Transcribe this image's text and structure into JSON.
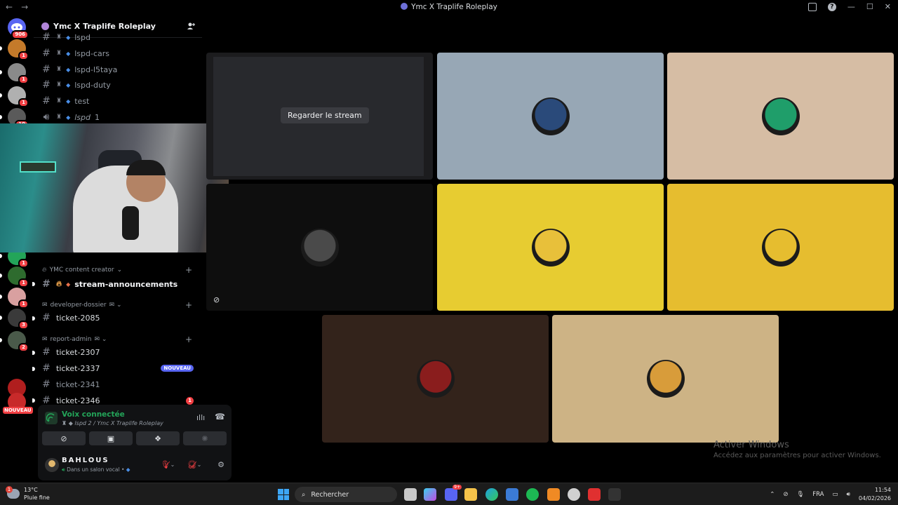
{
  "window": {
    "title": "Ymc X Traplife Roleplay",
    "back": "←",
    "forward": "→",
    "help_icon": "?",
    "minimize": "—",
    "maximize": "☐",
    "close": "✕"
  },
  "rail": {
    "home_badge": "906",
    "servers": [
      {
        "badge": "1",
        "color": "#c47a2a"
      },
      {
        "badge": "1",
        "color": "#8a8a8a"
      },
      {
        "badge": "1",
        "color": "#b0b0b0"
      },
      {
        "badge": "10",
        "color": "#5a5a5a"
      },
      {
        "badge": "1",
        "color": "#23a559"
      },
      {
        "badge": "1",
        "color": "#2e6b2e"
      },
      {
        "badge": "1",
        "color": "#d9a0a0"
      },
      {
        "badge": "3",
        "color": "#3a3a3a"
      },
      {
        "badge": "2",
        "color": "#4a5a4a"
      }
    ],
    "nouveau_label": "NOUVEAU",
    "extra_badge": "1"
  },
  "sidebar": {
    "server_name": "Ymc X Traplife Roleplay",
    "channels_top": [
      {
        "name": "lspd"
      },
      {
        "name": "lspd-cars"
      },
      {
        "name": "lspd-l5taya"
      },
      {
        "name": "lspd-duty"
      },
      {
        "name": "test"
      }
    ],
    "voice_channel": {
      "name": "lspd",
      "count": "1"
    },
    "categories": [
      {
        "label": "YMC content creator"
      },
      {
        "label": "developer-dossier"
      },
      {
        "label": "report-admin"
      }
    ],
    "channels": {
      "stream_announcements": "stream-announcements",
      "ticket_2085": "ticket-2085",
      "ticket_2307": "ticket-2307",
      "ticket_2337": "ticket-2337",
      "ticket_2341": "ticket-2341",
      "ticket_2346": "ticket-2346"
    },
    "nouveau_badge": "NOUVEAU",
    "unread_count": "1"
  },
  "voice_panel": {
    "status": "Voix connectée",
    "channel_path": "lspd 2 / Ymc X Traplife Roleplay"
  },
  "user_panel": {
    "name": "BAHLOUS",
    "status": "Dans un salon vocal •"
  },
  "stage": {
    "watch_stream_label": "Regarder le stream",
    "tiles": [
      {
        "bg": "#1c1c1e",
        "type": "stream"
      },
      {
        "bg": "#97a7b5",
        "avatar": "#2a4a7a"
      },
      {
        "bg": "#d6bda4",
        "avatar": "#1f9e6a"
      },
      {
        "bg": "#0e0e0e",
        "avatar": "#4a4a4a"
      },
      {
        "bg": "#e7cc31",
        "avatar": "#e8c03a"
      },
      {
        "bg": "#e6bd2f",
        "avatar": "#e6bd2f"
      },
      {
        "bg": "#33231b",
        "avatar": "#8a1d1d"
      },
      {
        "bg": "#cdb385",
        "avatar": "#d89c3a"
      }
    ]
  },
  "watermark": {
    "line1": "Activer Windows",
    "line2": "Accédez aux paramètres pour activer Windows."
  },
  "taskbar": {
    "weather_temp": "13°C",
    "weather_desc": "Pluie fine",
    "weather_badge": "1",
    "search_placeholder": "Rechercher",
    "discord_badge": "9+",
    "lang": "FRA",
    "time": "11:54",
    "date": "04/02/2026"
  }
}
